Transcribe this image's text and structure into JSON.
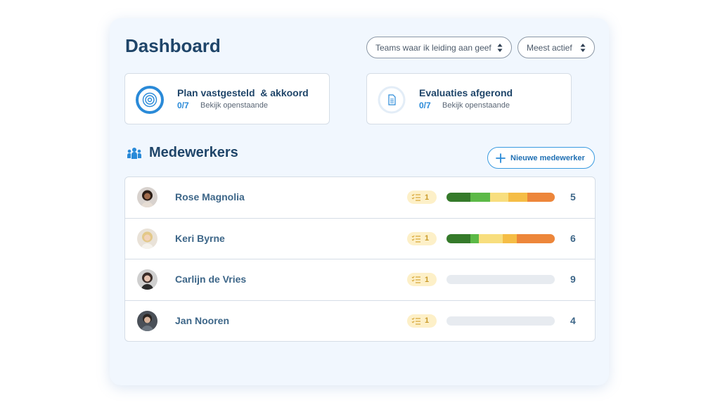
{
  "dashboard": {
    "title": "Dashboard"
  },
  "filters": {
    "teams": "Teams waar ik leiding aan geef",
    "sort": "Meest actief"
  },
  "stats": [
    {
      "icon": "target-ring-icon",
      "label": "Plan vastgesteld  & akkoord",
      "count": "0/7",
      "link": "Bekijk openstaande"
    },
    {
      "icon": "document-icon",
      "label": "Evaluaties afgerond",
      "count": "0/7",
      "link": "Bekijk openstaande"
    }
  ],
  "employees": {
    "title": "Medewerkers",
    "add_label": "Nieuwe medewerker",
    "rows": [
      {
        "name": "Rose Magnolia",
        "tasks": "1",
        "score": "5",
        "progress": [
          {
            "fraction": 0.22,
            "color": "#357a2a"
          },
          {
            "fraction": 0.18,
            "color": "#5cb947"
          },
          {
            "fraction": 0.17,
            "color": "#f8de7e"
          },
          {
            "fraction": 0.18,
            "color": "#f5bd46"
          },
          {
            "fraction": 0.25,
            "color": "#ed863a"
          }
        ]
      },
      {
        "name": "Keri Byrne",
        "tasks": "1",
        "score": "6",
        "progress": [
          {
            "fraction": 0.22,
            "color": "#357a2a"
          },
          {
            "fraction": 0.08,
            "color": "#5cb947"
          },
          {
            "fraction": 0.22,
            "color": "#f8de7e"
          },
          {
            "fraction": 0.13,
            "color": "#f5bd46"
          },
          {
            "fraction": 0.35,
            "color": "#ed863a"
          }
        ]
      },
      {
        "name": "Carlijn de Vries",
        "tasks": "1",
        "score": "9",
        "progress": []
      },
      {
        "name": "Jan Nooren",
        "tasks": "1",
        "score": "4",
        "progress": []
      }
    ]
  },
  "colors": {
    "accent": "#2a8ad8",
    "heading": "#1f4569",
    "badge_bg": "#fdf0c8"
  }
}
